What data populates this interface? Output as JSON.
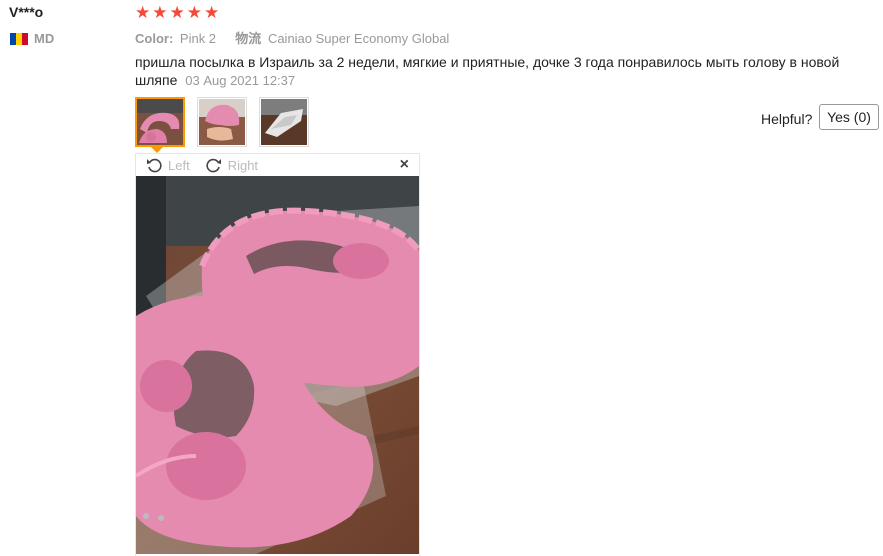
{
  "user": {
    "name": "V***o",
    "country_code": "MD",
    "flag_colors": [
      "#0046ae",
      "#ffd200",
      "#cc092f"
    ]
  },
  "rating": {
    "stars": 5,
    "max": 5,
    "star_char": "★",
    "color": "#f44a3b"
  },
  "meta": {
    "color_label": "Color:",
    "color_value": "Pink 2",
    "logistics_label": "物流",
    "logistics_value": "Cainiao Super Economy Global"
  },
  "review": {
    "text": "пришла посылка в Израиль за 2 недели, мягкие и приятные, дочке 3 года понравилось мыть голову в новой шляпе",
    "date": "03 Aug 2021 12:37"
  },
  "thumbnails": [
    {
      "name": "photo-1",
      "selected": true
    },
    {
      "name": "photo-2",
      "selected": false
    },
    {
      "name": "photo-3",
      "selected": false
    }
  ],
  "helpful": {
    "label": "Helpful?",
    "yes_button": "Yes (0)"
  },
  "viewer": {
    "rotate_left_label": "Left",
    "rotate_right_label": "Right",
    "close_symbol": "×",
    "icons": [
      "rotate-left-icon",
      "rotate-right-icon",
      "close-icon"
    ]
  },
  "colors": {
    "accent": "#ff9900",
    "hat_pink": "#e58bb0"
  }
}
